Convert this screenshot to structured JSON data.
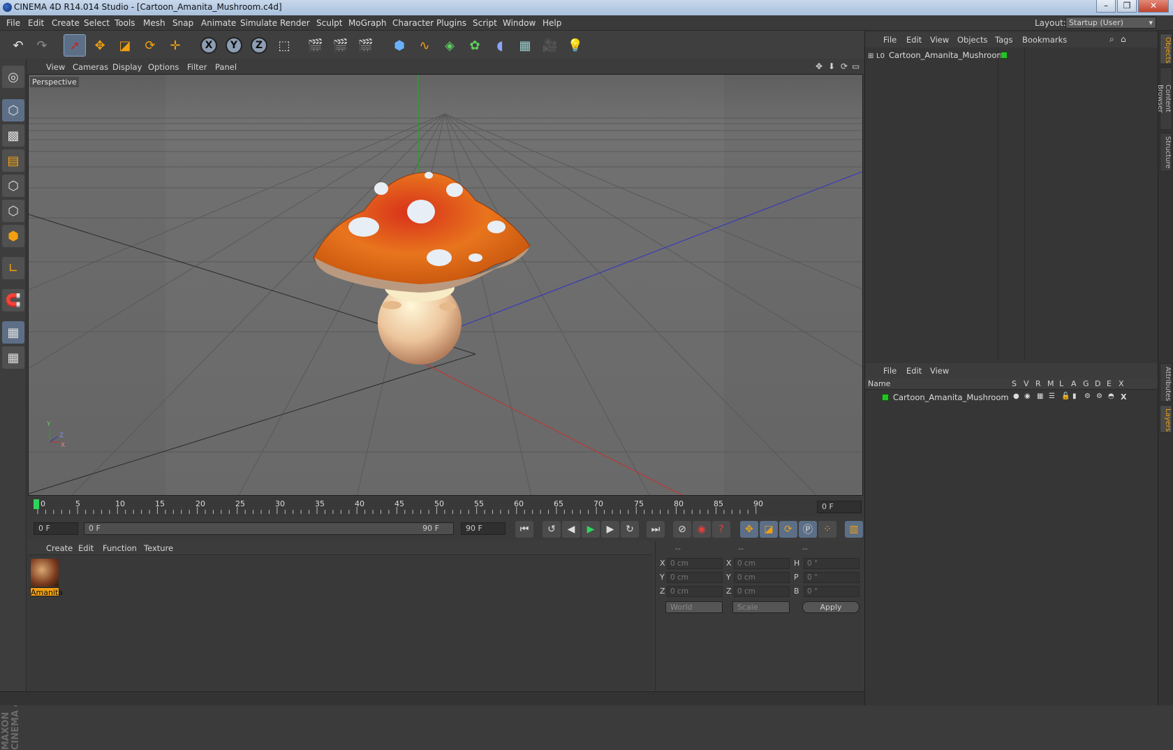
{
  "window": {
    "title": "CINEMA 4D R14.014 Studio - [Cartoon_Amanita_Mushroom.c4d]",
    "minimize": "–",
    "restore": "❐",
    "close": "✕"
  },
  "menubar": {
    "items": [
      "File",
      "Edit",
      "Create",
      "Select",
      "Tools",
      "Mesh",
      "Snap",
      "Animate",
      "Simulate",
      "Render",
      "Sculpt",
      "MoGraph",
      "Character",
      "Plugins",
      "Script",
      "Window",
      "Help"
    ],
    "layout_label": "Layout:",
    "layout_value": "Startup (User)"
  },
  "viewport": {
    "menu": [
      "View",
      "Cameras",
      "Display",
      "Options",
      "Filter",
      "Panel"
    ],
    "camera_label": "Perspective",
    "axis_y": "Y",
    "axis_z": "Z",
    "axis_x": "X"
  },
  "timeline": {
    "ticks": [
      "0",
      "5",
      "10",
      "15",
      "20",
      "25",
      "30",
      "35",
      "40",
      "45",
      "50",
      "55",
      "60",
      "65",
      "70",
      "75",
      "80",
      "85",
      "90"
    ],
    "current_frame": "0 F"
  },
  "playback": {
    "start_field": "0 F",
    "range_start": "0 F",
    "range_end": "90 F",
    "end_field": "90 F"
  },
  "materials": {
    "menu": [
      "Create",
      "Edit",
      "Function",
      "Texture"
    ],
    "items": [
      {
        "label": "Amanita"
      }
    ]
  },
  "coordinates": {
    "headers": [
      "--",
      "--",
      "--"
    ],
    "rows": [
      {
        "a": "X",
        "av": "0 cm",
        "b": "X",
        "bv": "0 cm",
        "c": "H",
        "cv": "0 °"
      },
      {
        "a": "Y",
        "av": "0 cm",
        "b": "Y",
        "bv": "0 cm",
        "c": "P",
        "cv": "0 °"
      },
      {
        "a": "Z",
        "av": "0 cm",
        "b": "Z",
        "bv": "0 cm",
        "c": "B",
        "cv": "0 °"
      }
    ],
    "world": "World",
    "scale": "Scale",
    "apply": "Apply"
  },
  "object_manager": {
    "menu": [
      "File",
      "Edit",
      "View",
      "Objects",
      "Tags",
      "Bookmarks"
    ],
    "object_name": "Cartoon_Amanita_Mushroom"
  },
  "layer_manager": {
    "menu": [
      "File",
      "Edit",
      "View"
    ],
    "columns": [
      "Name",
      "S",
      "V",
      "R",
      "M",
      "L",
      "A",
      "G",
      "D",
      "E",
      "X"
    ],
    "layer_name": "Cartoon_Amanita_Mushroom"
  },
  "side_tabs": {
    "top": [
      "Objects",
      "Content Browser",
      "Structure"
    ],
    "bottom": [
      "Attributes",
      "Layers"
    ]
  },
  "branding": "MAXON CINEMA 4D",
  "colors": {
    "accent": "#f2a00f",
    "layer_green": "#27c127",
    "selected_tool": "#5c6f87"
  }
}
